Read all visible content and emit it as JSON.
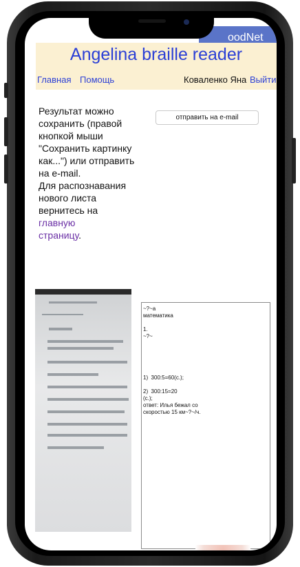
{
  "brand": {
    "name": "oodNet"
  },
  "header": {
    "title": "Angelina braille reader",
    "nav": {
      "home": "Главная",
      "help": "Помощь",
      "user": "Коваленко Яна",
      "logout": "Выйти"
    }
  },
  "result": {
    "text_lines": [
      "Результат можно",
      "сохранить (правой",
      "кнопкой мыши",
      "\"Сохранить картинку",
      "как...\") или отправить",
      "на e-mail.",
      "Для распознавания",
      "нового листа",
      "вернитесь на"
    ],
    "link_text_1": "главную",
    "link_text_2": "страницу",
    "period": "."
  },
  "email_button_label": "отправить на e-mail",
  "recognized_text": "~?~а\nматематика\n\n1.\n~?~\n\n\n\n\n\n1)  300:5=60(с.);\n\n2)  300:15=20\n(с.);\nответ: Илья бежал со\nскоростью 15 км~?~/ч."
}
